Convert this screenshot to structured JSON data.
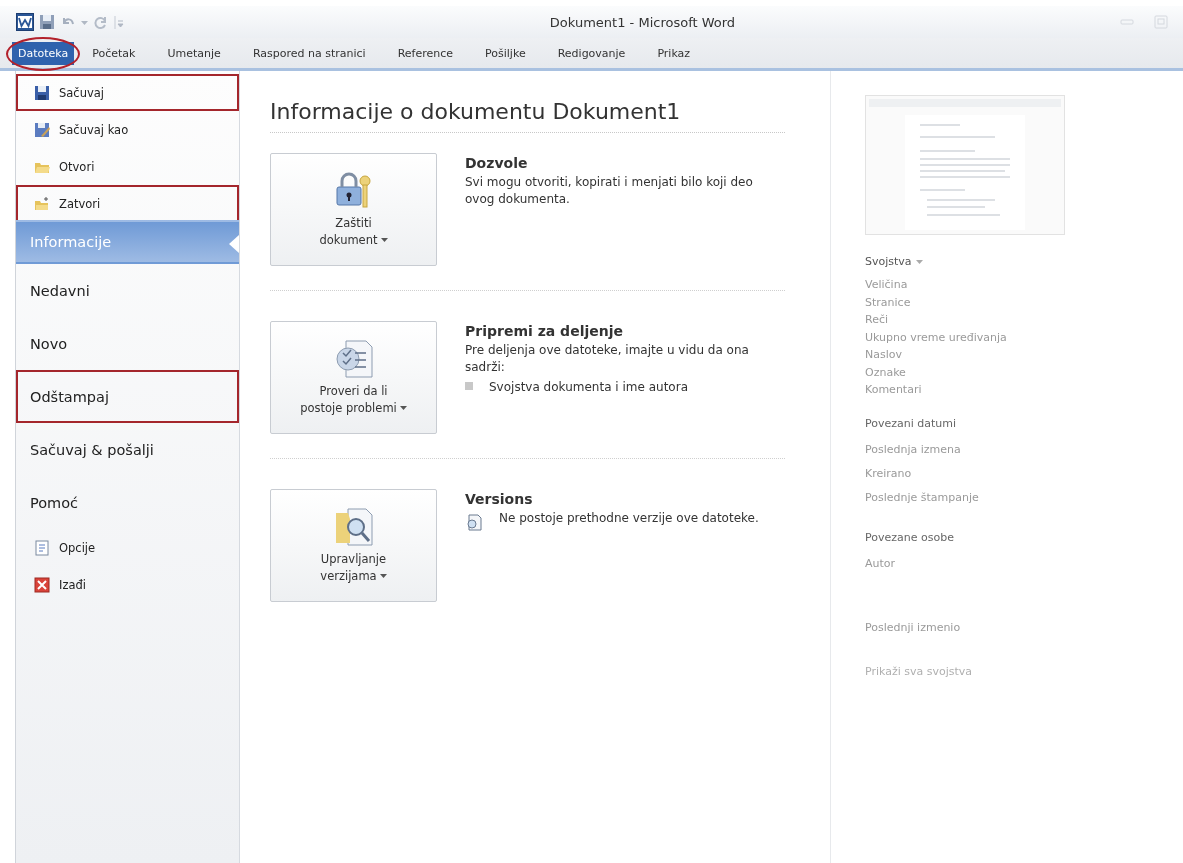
{
  "window": {
    "title": "Dokument1  -  Microsoft Word"
  },
  "tabs": [
    {
      "label": "Datoteka",
      "selected": true,
      "annotated": true
    },
    {
      "label": "Početak",
      "selected": false,
      "annotated": false
    },
    {
      "label": "Umetanje",
      "selected": false,
      "annotated": false
    },
    {
      "label": "Raspored na stranici",
      "selected": false,
      "annotated": false
    },
    {
      "label": "Reference",
      "selected": false,
      "annotated": false
    },
    {
      "label": "Pošiljke",
      "selected": false,
      "annotated": false
    },
    {
      "label": "Redigovanje",
      "selected": false,
      "annotated": false
    },
    {
      "label": "Prikaz",
      "selected": false,
      "annotated": false
    }
  ],
  "sidebar": {
    "items": [
      {
        "kind": "command",
        "label": "Sačuvaj",
        "selected": false,
        "annotated": true
      },
      {
        "kind": "command",
        "label": "Sačuvaj kao",
        "selected": false,
        "annotated": false
      },
      {
        "kind": "command",
        "label": "Otvori",
        "selected": false,
        "annotated": false
      },
      {
        "kind": "command",
        "label": "Zatvori",
        "selected": false,
        "annotated": true
      },
      {
        "kind": "page",
        "label": "Informacije",
        "selected": true,
        "annotated": false
      },
      {
        "kind": "page",
        "label": "Nedavni",
        "selected": false,
        "annotated": false
      },
      {
        "kind": "page",
        "label": "Novo",
        "selected": false,
        "annotated": false
      },
      {
        "kind": "page",
        "label": "Odštampaj",
        "selected": false,
        "annotated": true
      },
      {
        "kind": "page",
        "label": "Sačuvaj & pošalji",
        "selected": false,
        "annotated": false
      },
      {
        "kind": "page",
        "label": "Pomoć",
        "selected": false,
        "annotated": false
      },
      {
        "kind": "command",
        "label": "Opcije",
        "selected": false,
        "annotated": false
      },
      {
        "kind": "command",
        "label": "Izađi",
        "selected": false,
        "annotated": false
      }
    ]
  },
  "main": {
    "title": "Informacije o dokumentu Dokument1",
    "sections": [
      {
        "button": "Zaštiti\ndokument",
        "heading": "Dozvole",
        "text": "Svi mogu otvoriti, kopirati i menjati bilo koji deo ovog dokumenta."
      },
      {
        "button": "Proveri da li\npostoje problemi",
        "heading": "Pripremi za deljenje",
        "text": "Pre deljenja ove datoteke, imajte u vidu da ona sadrži:",
        "bullets": [
          "Svojstva dokumenta i ime autora"
        ]
      },
      {
        "button": "Upravljanje\nverzijama",
        "heading": "Versions",
        "note": "Ne postoje prethodne verzije ove datoteke."
      }
    ]
  },
  "properties": {
    "title": "Svojstva",
    "groups": [
      {
        "rows": [
          "Veličina",
          "Stranice",
          "Reči",
          "Ukupno vreme uređivanja",
          "Naslov",
          "Oznake",
          "Komentari"
        ]
      },
      {
        "heading": "Povezani datumi",
        "rows": [
          "Poslednja izmena",
          "Kreirano",
          "Poslednje štampanje"
        ]
      },
      {
        "heading": "Povezane osobe",
        "rows": [
          "Autor"
        ]
      },
      {
        "rows": [
          "Poslednji izmenio"
        ]
      }
    ],
    "link": "Prikaži sva svojstva"
  }
}
